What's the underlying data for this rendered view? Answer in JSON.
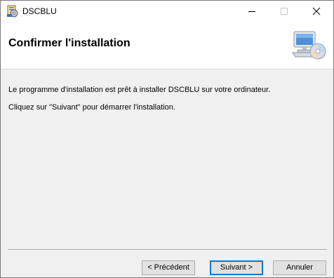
{
  "window": {
    "title": "DSCBLU",
    "controls": {
      "minimize_icon": "minimize-icon",
      "maximize_icon": "maximize-icon",
      "close_icon": "close-icon"
    }
  },
  "header": {
    "title": "Confirmer l'installation",
    "icon": "computer-cd-icon"
  },
  "content": {
    "line1": "Le programme d'installation est prêt à installer DSCBLU sur votre ordinateur.",
    "line2": "Cliquez sur \"Suivant\" pour démarrer l'installation."
  },
  "buttons": {
    "previous": "< Précédent",
    "next": "Suivant >",
    "cancel": "Annuler"
  },
  "colors": {
    "accent": "#0078d7",
    "background": "#f0f0f0",
    "header_background": "#ffffff"
  }
}
